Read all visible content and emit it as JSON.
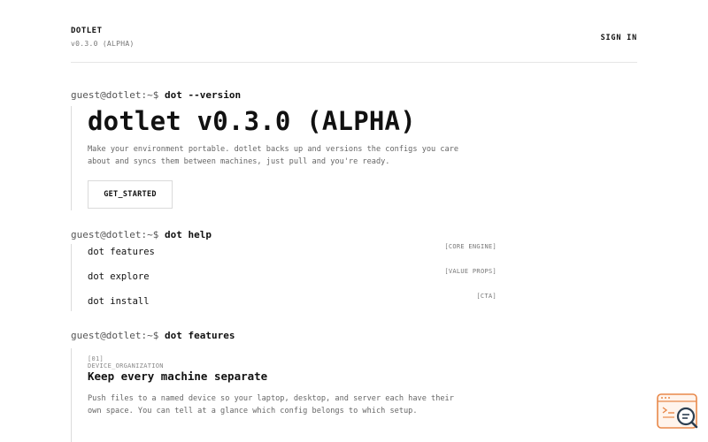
{
  "header": {
    "brand": "DOTLET",
    "version": "v0.3.0 (ALPHA)",
    "sign_in": "SIGN IN"
  },
  "prompt": "guest@dotlet:~$",
  "sections": {
    "version": {
      "command": "dot --version",
      "title": "dotlet v0.3.0 (ALPHA)",
      "description": "Make your environment portable. dotlet backs up and versions the configs you care about and syncs them between machines, just pull and you're ready.",
      "cta": "GET_STARTED"
    },
    "help": {
      "command": "dot help",
      "items": [
        {
          "label": "dot features",
          "tag": "[CORE ENGINE]"
        },
        {
          "label": "dot explore",
          "tag": "[VALUE PROPS]"
        },
        {
          "label": "dot install",
          "tag": "[CTA]"
        }
      ]
    },
    "features": {
      "command": "dot features",
      "items": [
        {
          "tag": "[01] DEVICE_ORGANIZATION",
          "title": "Keep every machine separate",
          "description": "Push files to a named device so your laptop, desktop, and server each have their own space. You can tell at a glance which config belongs to which setup."
        }
      ]
    }
  },
  "widget": {
    "icon": "terminal-search-icon",
    "accent": "#e8884a"
  },
  "colors": {
    "text": "#111111",
    "muted": "#666666",
    "border": "#dcdcdc",
    "accent": "#e8884a"
  }
}
